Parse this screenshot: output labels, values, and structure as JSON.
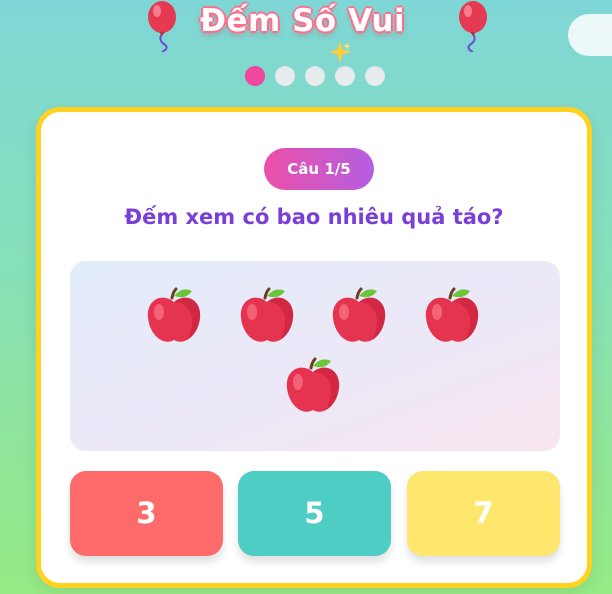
{
  "header": {
    "title": "Đếm Số Vui"
  },
  "progress": {
    "current": 1,
    "total": 5
  },
  "question": {
    "badge": "Câu 1/5",
    "text": "Đếm xem có bao nhiêu quả táo?",
    "item_icon": "apple-icon",
    "item_count": 5
  },
  "answers": [
    {
      "label": "3",
      "color": "#ff6b6b"
    },
    {
      "label": "5",
      "color": "#4ecdc4"
    },
    {
      "label": "7",
      "color": "#ffe66d"
    }
  ],
  "colors": {
    "accent_pink": "#f2479c",
    "question_purple": "#7a3fd8",
    "card_border": "#ffd21f"
  }
}
